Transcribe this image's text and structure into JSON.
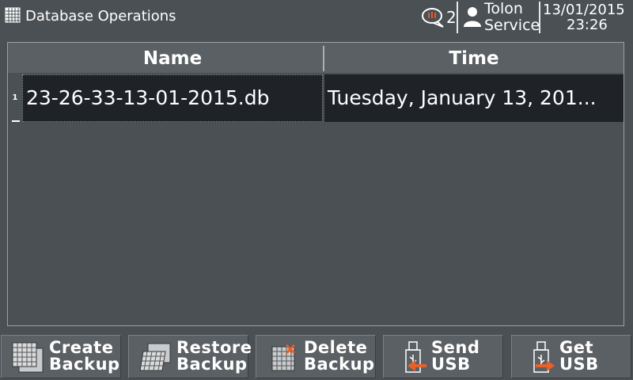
{
  "header": {
    "title": "Database Operations",
    "app_icon": "grid-icon",
    "alarm_icon": "alarm-bubble-icon",
    "alarm_count": "2",
    "user_icon": "user-icon",
    "user_name": "Tolon",
    "user_role": "Service",
    "date": "13/01/2015",
    "time": "23:26"
  },
  "table": {
    "columns": [
      "Name",
      "Time"
    ],
    "rows": [
      {
        "index": "1",
        "name": "23-26-33-13-01-2015.db",
        "time": "Tuesday, January 13, 201..."
      }
    ]
  },
  "buttons": [
    {
      "label": "Create\nBackup",
      "icon": "create-backup-icon"
    },
    {
      "label": "Restore\nBackup",
      "icon": "restore-backup-icon"
    },
    {
      "label": "Delete\nBackup",
      "icon": "delete-backup-icon"
    },
    {
      "label": "Send\nUSB",
      "icon": "usb-send-icon"
    },
    {
      "label": "Get\nUSB",
      "icon": "usb-get-icon"
    }
  ],
  "colors": {
    "background": "#4b5054",
    "row_background": "#1f2328",
    "arrow_accent": "#e8602a"
  }
}
